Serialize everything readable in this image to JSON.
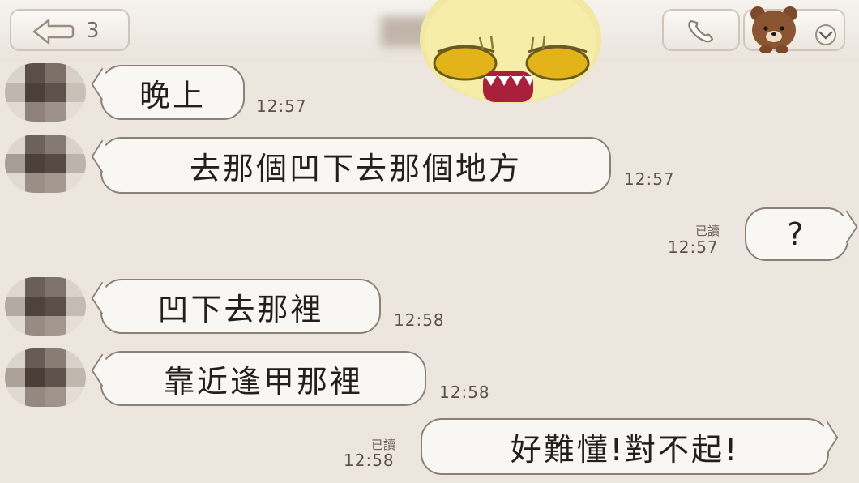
{
  "header": {
    "back_count": "3"
  },
  "icons": {
    "back": "back-arrow-icon",
    "call": "phone-icon",
    "menu": "bear-sticker-dropdown-icon",
    "sticker": "yawning-face-sticker"
  },
  "messages": [
    {
      "side": "in",
      "text": "晚上",
      "time": "12:57"
    },
    {
      "side": "in",
      "text": "去那個凹下去那個地方",
      "time": "12:57"
    },
    {
      "side": "out",
      "text": "?",
      "time": "12:57",
      "read": "已讀"
    },
    {
      "side": "in",
      "text": "凹下去那裡",
      "time": "12:58"
    },
    {
      "side": "in",
      "text": "靠近逢甲那裡",
      "time": "12:58"
    },
    {
      "side": "out",
      "text": "好難懂!對不起!",
      "time": "12:58",
      "read": "已讀"
    }
  ]
}
